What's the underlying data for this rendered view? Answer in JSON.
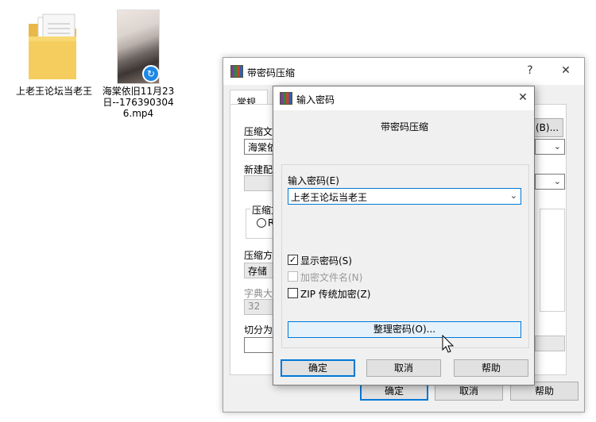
{
  "desktop": {
    "folder_label": "上老王论坛当老王",
    "video_label": "海棠依旧11月23日--1763903046.mp4"
  },
  "bg_dialog": {
    "title": "带密码压缩",
    "help_glyph": "?",
    "close_glyph": "✕",
    "tab_general": "常规",
    "label_archive_name": "压缩文",
    "archive_name_value": "海棠依",
    "browse_button": "(B)...",
    "label_profile": "新建配",
    "label_format_group": "压缩文",
    "format_radio_text": "R",
    "label_method": "压缩方",
    "method_value": "存储",
    "label_dict": "字典大",
    "dict_value": "32",
    "label_split": "切分为",
    "ok_button": "确定",
    "cancel_button": "取消",
    "help_button": "帮助"
  },
  "password_dialog": {
    "title": "输入密码",
    "close_glyph": "✕",
    "header": "带密码压缩",
    "password_label": "输入密码(E)",
    "password_value": "上老王论坛当老王",
    "show_password_label": "显示密码(S)",
    "show_password_checked": "✓",
    "encrypt_filenames_label": "加密文件名(N)",
    "zip_legacy_label": "ZIP 传统加密(Z)",
    "organize_button": "整理密码(O)...",
    "ok_button": "确定",
    "cancel_button": "取消",
    "help_button": "帮助"
  },
  "icons": {
    "dropdown": "⌄",
    "video_badge": "↻"
  }
}
